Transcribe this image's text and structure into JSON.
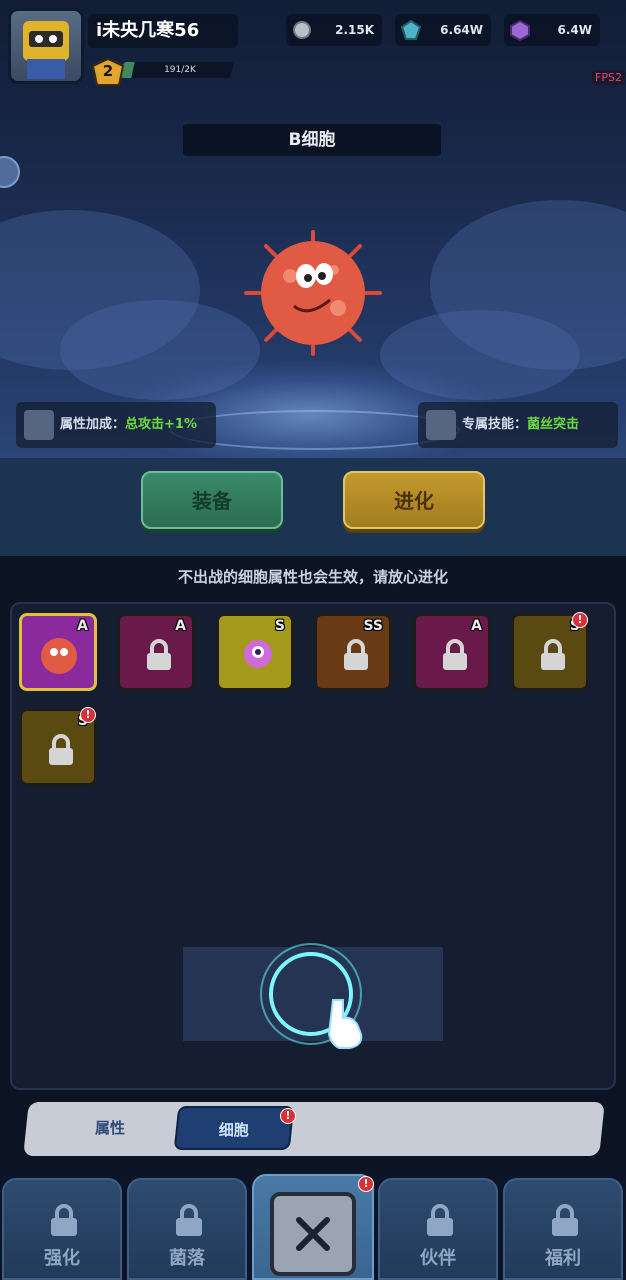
{
  "header": {
    "player_name": "i未央几寒56",
    "level": "2",
    "xp_text": "191/2K",
    "xp_progress": 0.0955,
    "currencies": [
      {
        "icon": "coin-icon",
        "value": "2.15K"
      },
      {
        "icon": "gem-icon",
        "value": "6.64W"
      },
      {
        "icon": "cube-icon",
        "value": "6.4W"
      }
    ],
    "fps_label": "FPS2"
  },
  "hero": {
    "title": "B细胞",
    "attr_label": "属性加成：",
    "attr_value": "总攻击+1%",
    "skill_label": "专属技能：",
    "skill_value": "菌丝突击"
  },
  "actions": {
    "equip_label": "装备",
    "evolve_label": "进化"
  },
  "hint_text": "不出战的细胞属性也会生效，请放心进化",
  "cells": [
    {
      "grade": "A",
      "locked": false,
      "selected": true,
      "frame": "purple"
    },
    {
      "grade": "A",
      "locked": true,
      "frame": "magenta"
    },
    {
      "grade": "S",
      "locked": false,
      "frame": "yellow"
    },
    {
      "grade": "SS",
      "locked": true,
      "frame": "orange"
    },
    {
      "grade": "A",
      "locked": true,
      "frame": "magenta"
    },
    {
      "grade": "S",
      "locked": true,
      "frame": "yellow",
      "alert": "!"
    },
    {
      "grade": "S",
      "locked": true,
      "frame": "yellow",
      "alert": "!"
    }
  ],
  "subtabs": {
    "attributes": "属性",
    "cells": "细胞",
    "cells_alert": "!"
  },
  "nav": {
    "items": [
      "强化",
      "菌落",
      "伙伴",
      "福利"
    ],
    "center_alert": "!"
  },
  "colors": {
    "accent_green": "#6bdc3e",
    "alert_red": "#d8313a",
    "fps_red": "#e04a6a"
  }
}
